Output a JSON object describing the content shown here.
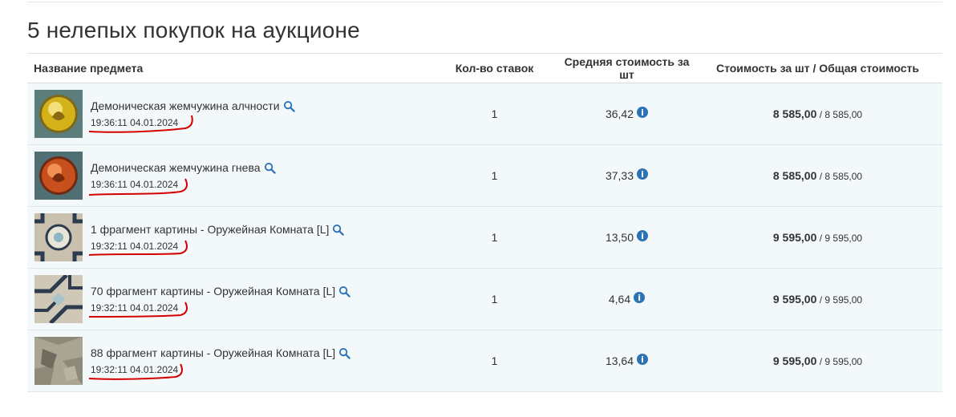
{
  "title": "5 нелепых покупок на аукционе",
  "table": {
    "headers": {
      "name": "Название предмета",
      "bids": "Кол-во ставок",
      "avg": "Средняя стоимость за шт",
      "cost": "Стоимость за шт / Общая стоимость"
    },
    "rows": [
      {
        "name": "Демоническая жемчужина алчности",
        "time": "19:36:11 04.01.2024",
        "bids": "1",
        "avg": "36,42",
        "price": "8 585,00",
        "sep": " / ",
        "total": "8 585,00",
        "icon": "demonic-pearl-greed"
      },
      {
        "name": "Демоническая жемчужина гнева",
        "time": "19:36:11 04.01.2024",
        "bids": "1",
        "avg": "37,33",
        "price": "8 585,00",
        "sep": " / ",
        "total": "8 585,00",
        "icon": "demonic-pearl-wrath"
      },
      {
        "name": "1 фрагмент картины - Оружейная Комната [L]",
        "time": "19:32:11 04.01.2024",
        "bids": "1",
        "avg": "13,50",
        "price": "9 595,00",
        "sep": " / ",
        "total": "9 595,00",
        "icon": "painting-fragment-tile"
      },
      {
        "name": "70 фрагмент картины - Оружейная Комната [L]",
        "time": "19:32:11 04.01.2024",
        "bids": "1",
        "avg": "4,64",
        "price": "9 595,00",
        "sep": " / ",
        "total": "9 595,00",
        "icon": "painting-fragment-pattern"
      },
      {
        "name": "88 фрагмент картины - Оружейная Комната [L]",
        "time": "19:32:11 04.01.2024",
        "bids": "1",
        "avg": "13,64",
        "price": "9 595,00",
        "sep": " / ",
        "total": "9 595,00",
        "icon": "painting-fragment-stone"
      }
    ]
  },
  "colors": {
    "row_bg": "#f3f8fb",
    "accent": "#2c73b5",
    "annotation": "#d40000"
  }
}
